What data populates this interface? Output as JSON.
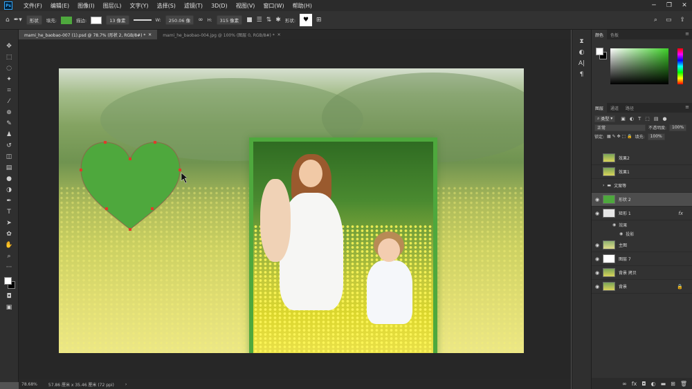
{
  "menu": [
    "文件(F)",
    "编辑(E)",
    "图像(I)",
    "图层(L)",
    "文字(Y)",
    "选择(S)",
    "滤镜(T)",
    "3D(D)",
    "视图(V)",
    "窗口(W)",
    "帮助(H)"
  ],
  "options": {
    "mode": "形状",
    "fill_label": "填充:",
    "stroke_label": "描边:",
    "stroke_size": "13 像素",
    "w_label": "W:",
    "w_value": "250.06 像",
    "h_label": "H:",
    "h_value": "315 像素",
    "shape_label": "形状:",
    "fill_color": "#4ea83d"
  },
  "tabs": [
    "mami_he_baobao-007 (1).psd @ 78.7% (形状 2, RGB/8#) *",
    "mami_he_baobao-004.jpg @ 100% (图层 0, RGB/8#) *"
  ],
  "status": {
    "zoom": "78.68%",
    "doc_size": "57.86 厘米 x 35.46 厘米 (72 ppi)"
  },
  "color_panel": {
    "tabs": [
      "颜色",
      "色板"
    ],
    "fg": "#ffffff",
    "bg": "#000000"
  },
  "layers_panel": {
    "tabs": [
      "图层",
      "通道",
      "路径"
    ],
    "filter": "类型",
    "blend": "正常",
    "opacity_label": "不透明度:",
    "opacity": "100%",
    "lock_label": "锁定:",
    "fill_label": "填充:",
    "fill": "100%",
    "layers": [
      {
        "name": "效果2",
        "visible": false,
        "thumb": "photo"
      },
      {
        "name": "效果1",
        "visible": false,
        "thumb": "photo"
      },
      {
        "name": "文案等",
        "visible": false,
        "thumb": "folder"
      },
      {
        "name": "形状 2",
        "visible": true,
        "thumb": "shape",
        "selected": true
      },
      {
        "name": "矩形 1",
        "visible": true,
        "thumb": "shape",
        "fx": "fx"
      },
      {
        "name": "主图",
        "visible": true,
        "thumb": "photo"
      },
      {
        "name": "图层 7",
        "visible": true,
        "thumb": "white"
      },
      {
        "name": "背景 拷贝",
        "visible": true,
        "thumb": "photo"
      },
      {
        "name": "背景",
        "visible": true,
        "thumb": "photo",
        "locked": true
      }
    ],
    "effects": [
      "效果",
      "投影"
    ]
  }
}
